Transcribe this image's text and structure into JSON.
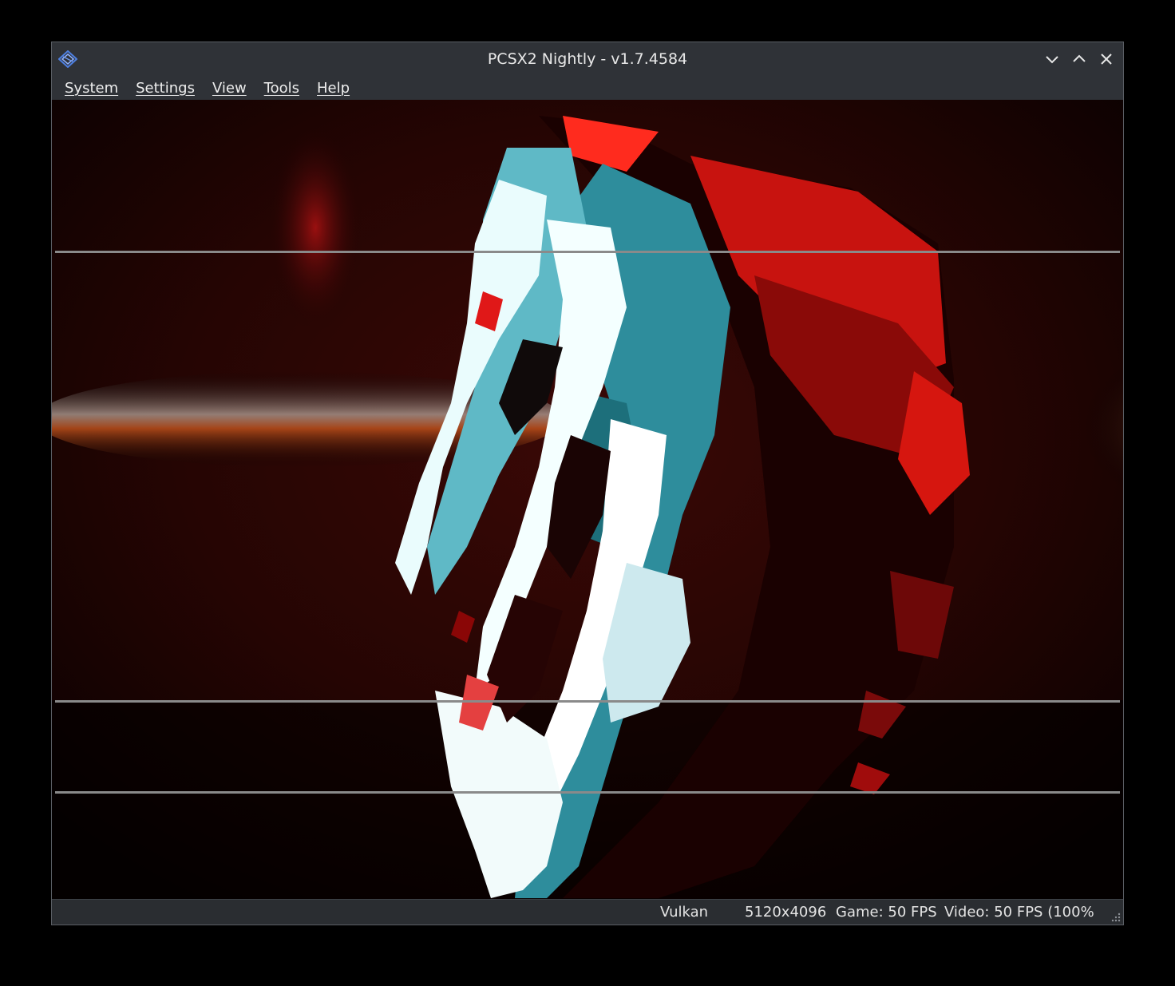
{
  "window": {
    "title": "PCSX2 Nightly - v1.7.4584"
  },
  "menu": {
    "items": [
      {
        "label": "System"
      },
      {
        "label": "Settings"
      },
      {
        "label": "View"
      },
      {
        "label": "Tools"
      },
      {
        "label": "Help"
      }
    ]
  },
  "status": {
    "renderer": "Vulkan",
    "resolution": "5120x4096",
    "game_fps": "Game: 50 FPS",
    "video_fps": "Video: 50 FPS (100%"
  },
  "icons": {
    "app": "pcsx2-logo-icon",
    "minimize": "chevron-down-icon",
    "maximize": "chevron-up-icon",
    "close": "close-icon",
    "resize": "resize-grip-icon"
  },
  "colors": {
    "titlebar": "#2f3237",
    "statusbar": "#2a2d31",
    "accent_red": "#e01818",
    "accent_cyan": "#3aa7b8"
  }
}
